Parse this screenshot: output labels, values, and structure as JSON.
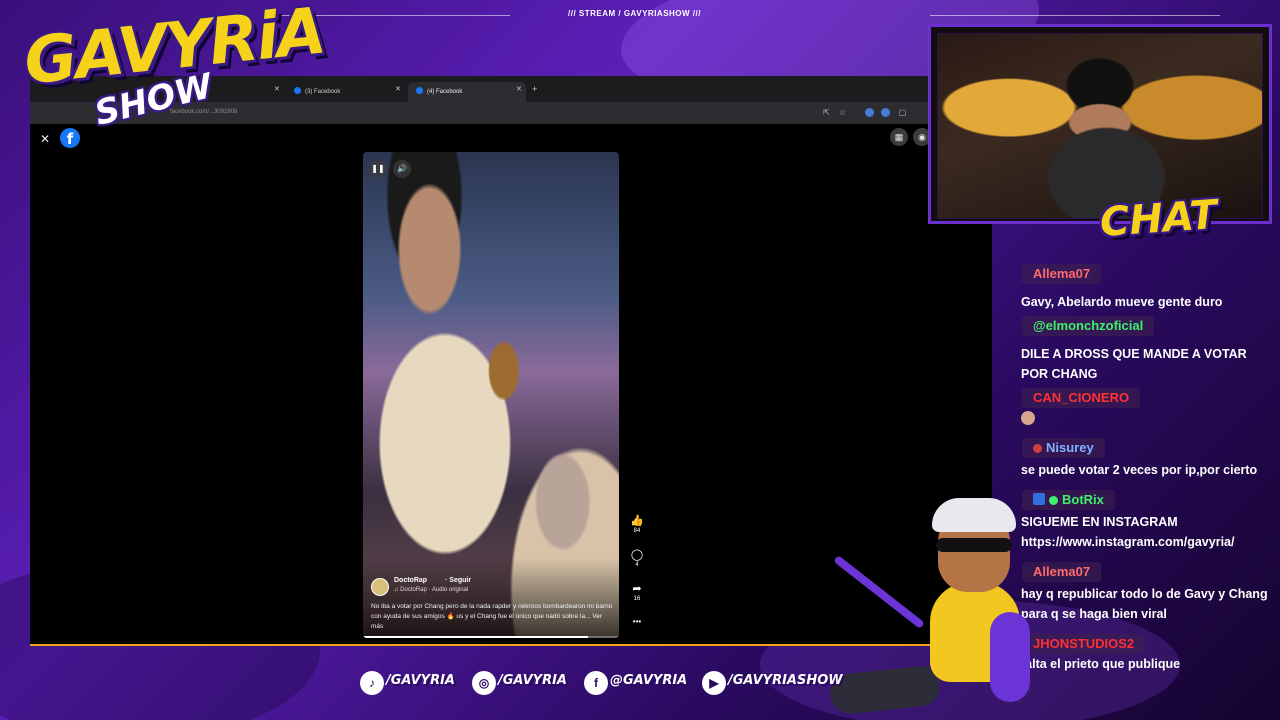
{
  "overlay": {
    "stream_label": "///  STREAM  /  GAVYRIASHOW  ///",
    "logo_main": "GAVYRiA",
    "logo_sub": "SHOW",
    "chat_title": "CHAT"
  },
  "browser": {
    "tabs": [
      {
        "label": "(3) Facebook",
        "active": false
      },
      {
        "label": "(4) Facebook",
        "active": true
      }
    ],
    "new_tab": "+",
    "url": "facebook.com/...3092808"
  },
  "facebook": {
    "close": "✕",
    "logo": "f",
    "menu_icon": "grid-icon",
    "messenger_icon": "messenger-icon"
  },
  "reel": {
    "author": "DoctoRap",
    "follow": "· Seguir",
    "audio": "♫ DoctoRap · Audio original",
    "caption": "No iba a votar por Chang pero de la nada rapder y nekroos bombardearon mi barrio con ayuda de sus amigos 🔥 us y el Chang fue el único que nadó sobre la... Ver más",
    "progress": 0.88,
    "likes": "84",
    "comments": "4",
    "shares": "16",
    "more": "•••"
  },
  "chat": {
    "messages": [
      {
        "user": "Allema07",
        "user_color": "#ff6b6b",
        "text": "Gavy, Abelardo mueve gente duro"
      },
      {
        "user": "@elmonchzoficial",
        "user_color": "#3ef06a",
        "text": "DILE A DROSS QUE MANDE A VOTAR POR CHANG"
      },
      {
        "user": "CAN_CIONERO",
        "user_color": "#ff3030",
        "text": ""
      },
      {
        "user": "Nisurey",
        "user_color": "#7fb3ff",
        "text": "se puede votar 2 veces por ip,por cierto"
      },
      {
        "user": "BotRix",
        "user_color": "#3ef06a",
        "text": "SIGUEME EN INSTAGRAM https://www.instagram.com/gavyria/"
      },
      {
        "user": "Allema07",
        "user_color": "#ff6b6b",
        "text": "hay q republicar todo lo de Gavy y Chang para q se haga bien viral"
      },
      {
        "user": "JHONSTUDIOS2",
        "user_color": "#ff3030",
        "text": "falta el prieto que publique"
      }
    ]
  },
  "socials": [
    {
      "icon": "tiktok-icon",
      "glyph": "♪",
      "label": "/GAVYRIA"
    },
    {
      "icon": "instagram-icon",
      "glyph": "◎",
      "label": "/GAVYRIA"
    },
    {
      "icon": "facebook-icon",
      "glyph": "f",
      "label": "@GAVYRIA"
    },
    {
      "icon": "youtube-icon",
      "glyph": "▶",
      "label": "/GAVYRIASHOW"
    }
  ]
}
